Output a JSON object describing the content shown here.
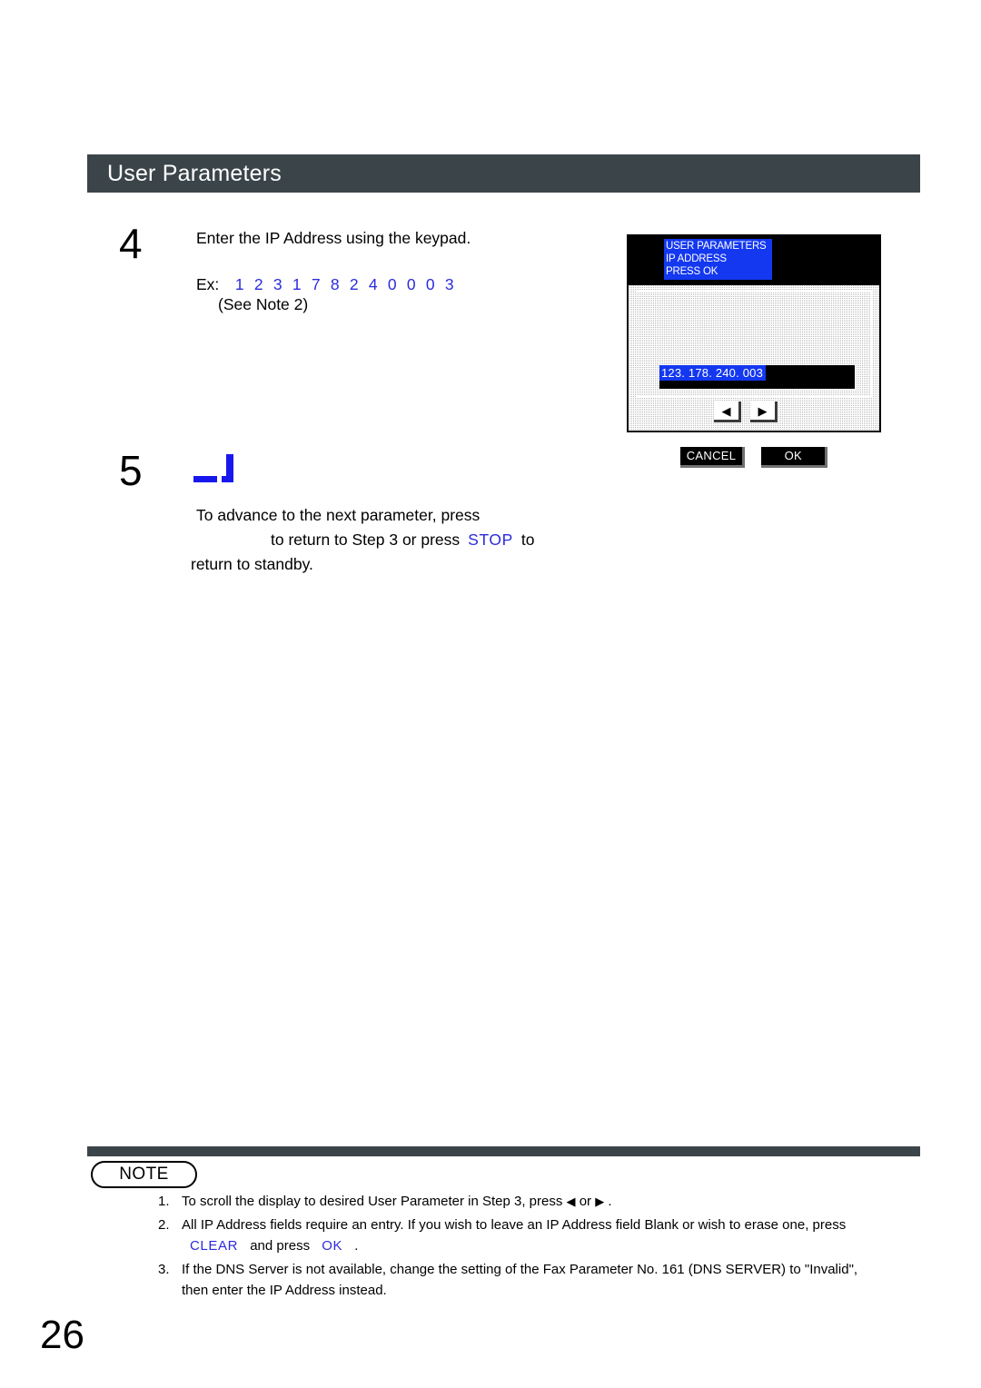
{
  "page": {
    "title": "User Parameters",
    "number": "26"
  },
  "steps": [
    {
      "number": "4",
      "instruction": "Enter the IP Address using the keypad.",
      "example_label": "Ex:",
      "example_digits": [
        "1",
        "2",
        "3",
        "1",
        "7",
        "8",
        "2",
        "4",
        "0",
        "0",
        "0",
        "3"
      ],
      "see_note": "(See Note 2)"
    },
    {
      "number": "5",
      "icon": "enter-key-icon",
      "line1": "To advance to the next parameter, press",
      "line2_a": "to return to Step 3 or press",
      "line2_key": "STOP",
      "line2_b": "to",
      "line3": "return to standby."
    }
  ],
  "lcd": {
    "status_lines": [
      "USER PARAMETERS",
      "IP ADDRESS",
      "PRESS OK"
    ],
    "ip_value": "123. 178. 240. 003",
    "arrow_left": "◀",
    "arrow_right": "▶",
    "cancel_label": "CANCEL",
    "ok_label": "OK"
  },
  "note": {
    "badge": "NOTE",
    "items": [
      {
        "marker": "1.",
        "text_a": "To scroll the display to desired User Parameter in Step 3, press",
        "arrow_left": "◀",
        "or": "or",
        "arrow_right": "▶",
        "text_b": "."
      },
      {
        "marker": "2.",
        "text_a": "All IP Address fields require an entry.  If you wish to leave an IP Address field Blank or wish to erase one, press",
        "key1": "CLEAR",
        "text_b": "and press",
        "key2": "OK",
        "text_c": "."
      },
      {
        "marker": "3.",
        "text_a": "If the DNS Server is not available, change the setting of the Fax Parameter No. 161 (DNS SERVER) to \"Invalid\",",
        "text_b": "then enter the IP Address instead."
      }
    ]
  },
  "colors": {
    "header_bar": "#3b4549",
    "key_blue": "#2b2bdd",
    "lcd_highlight": "#1438f0"
  }
}
